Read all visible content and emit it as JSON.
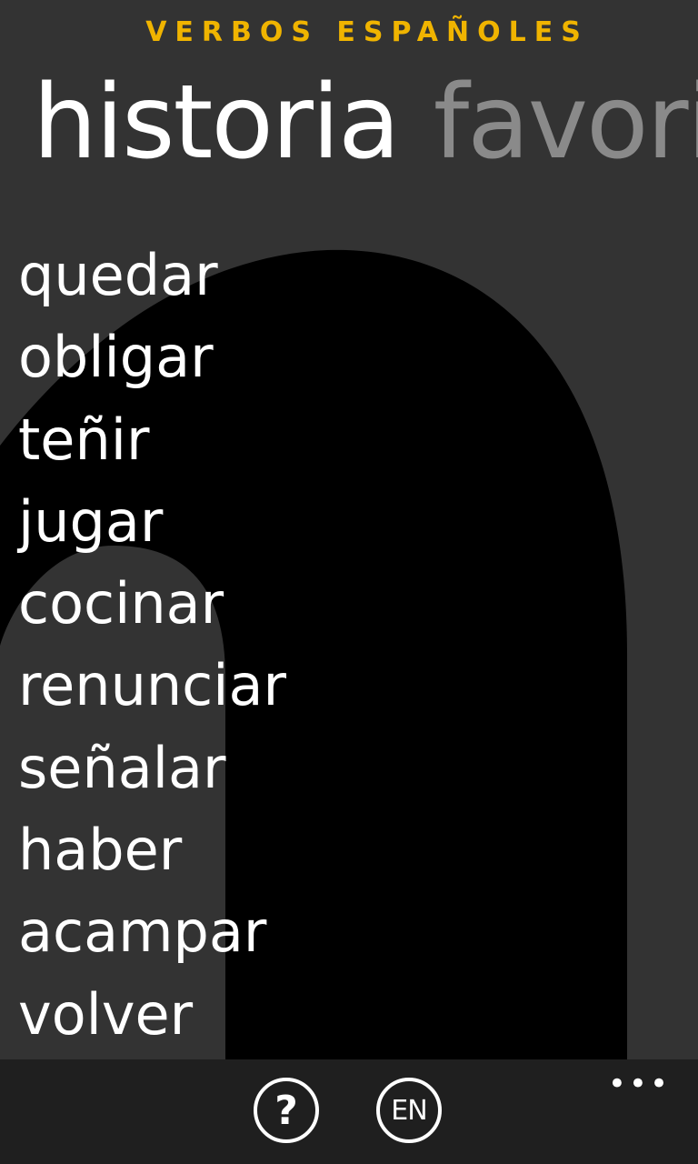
{
  "app": {
    "title": "VERBOS ESPAÑOLES"
  },
  "pivot": {
    "active_label": "historia",
    "next_label": "favorit"
  },
  "history_list": {
    "items": [
      {
        "label": "quedar"
      },
      {
        "label": "obligar"
      },
      {
        "label": "teñir"
      },
      {
        "label": "jugar"
      },
      {
        "label": "cocinar"
      },
      {
        "label": "renunciar"
      },
      {
        "label": "señalar"
      },
      {
        "label": "haber"
      },
      {
        "label": "acampar"
      },
      {
        "label": "volver"
      }
    ]
  },
  "app_bar": {
    "help_icon": "question-mark-icon",
    "help_glyph": "?",
    "language_label": "EN",
    "more_icon": "ellipsis-icon",
    "more_glyph": "•••"
  },
  "colors": {
    "accent": "#f0b400",
    "background": "#333333",
    "background_art": "#000000",
    "app_bar": "#1f1f1f",
    "text": "#ffffff",
    "inactive_header": "#8a8a8a"
  }
}
